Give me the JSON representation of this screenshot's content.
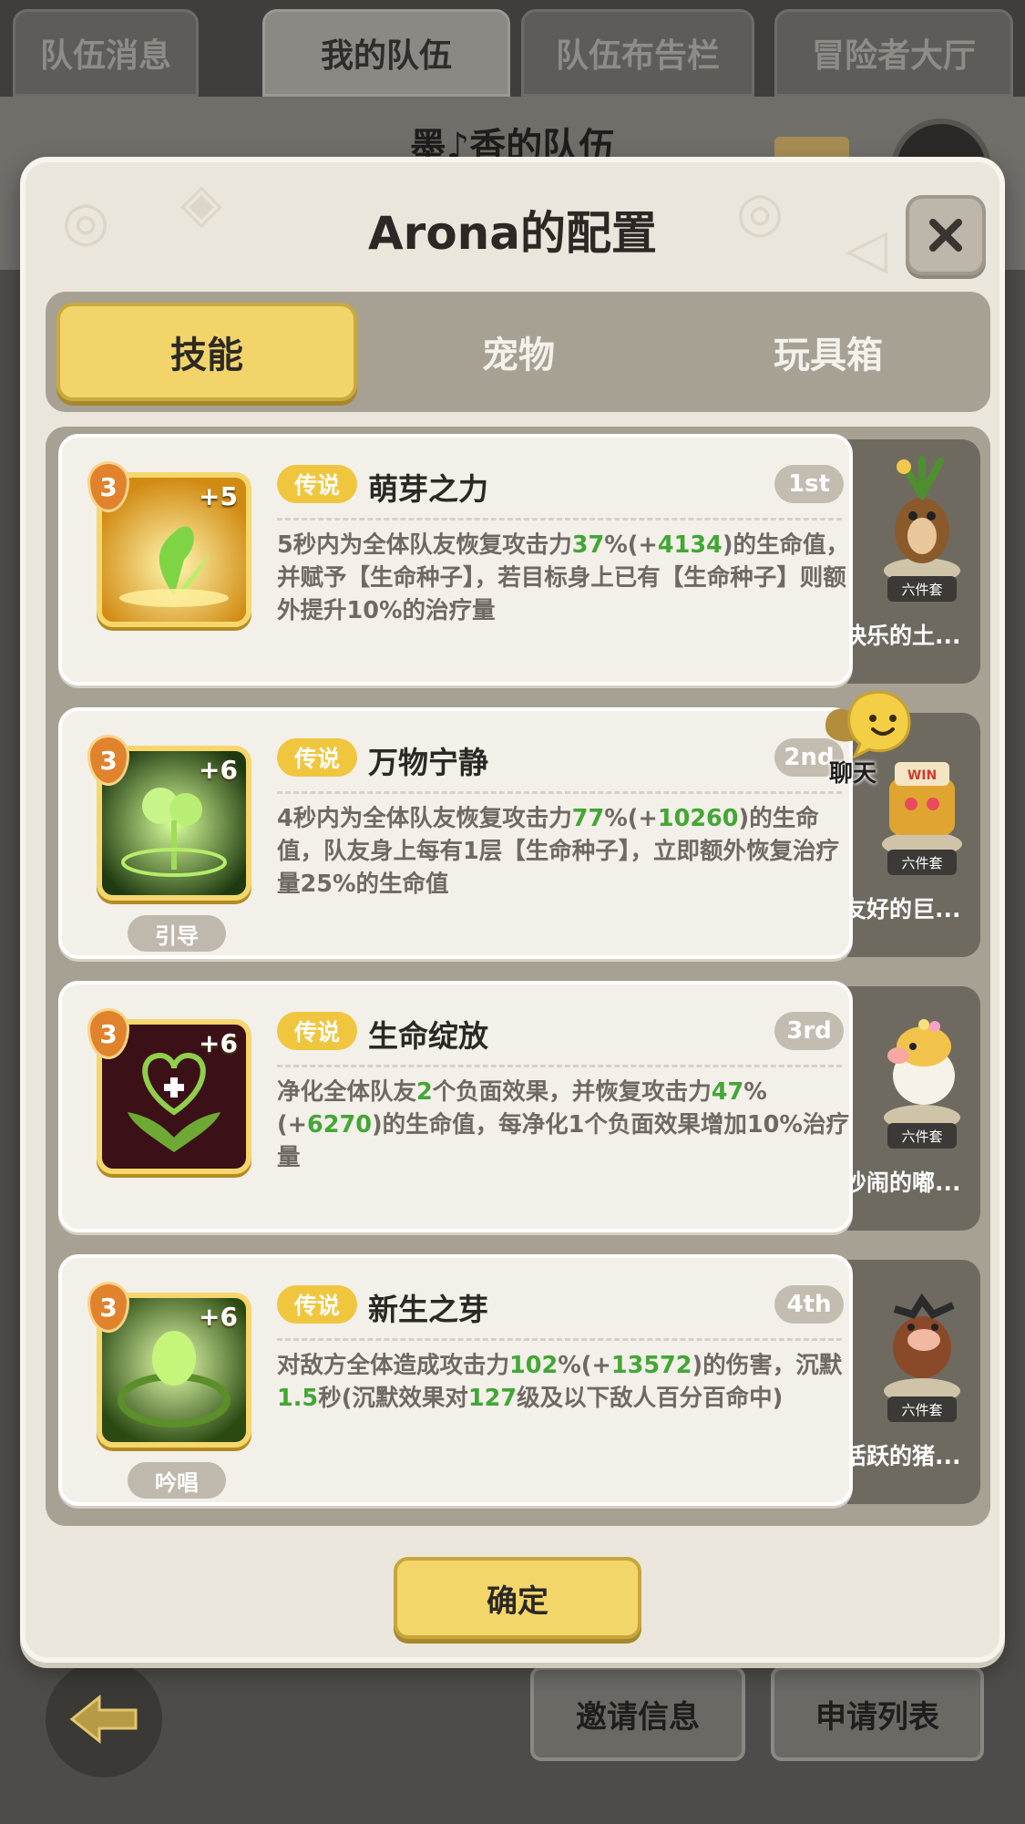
{
  "top_tabs": [
    "队伍消息",
    "我的队伍",
    "队伍布告栏",
    "冒险者大厅"
  ],
  "active_top_tab": 1,
  "background_title": "墨♪香的队伍",
  "modal": {
    "title": "Arona的配置",
    "tabs": [
      "技能",
      "宠物",
      "玩具箱"
    ],
    "active_tab": 0,
    "confirm_label": "确定"
  },
  "chat_label": "聊天",
  "bottom_buttons": [
    "邀请信息",
    "申请列表"
  ],
  "skills": [
    {
      "rarity": "传说",
      "name": "萌芽之力",
      "rank": "1st",
      "level": "3",
      "plus": "+5",
      "type_tag": "",
      "desc_parts": [
        {
          "t": "5秒内为全体队友恢复攻击力"
        },
        {
          "t": "37",
          "g": true
        },
        {
          "t": "%(+"
        },
        {
          "t": "4134",
          "g": true
        },
        {
          "t": ")的生命值，并赋予【生命种子】，若目标身上已有【生命种子】则额外提升10%的治疗量"
        }
      ],
      "pet_name": "快乐的土...",
      "pet_badge": "六件套"
    },
    {
      "rarity": "传说",
      "name": "万物宁静",
      "rank": "2nd",
      "level": "3",
      "plus": "+6",
      "type_tag": "引导",
      "desc_parts": [
        {
          "t": "4秒内为全体队友恢复攻击力"
        },
        {
          "t": "77",
          "g": true
        },
        {
          "t": "%(+"
        },
        {
          "t": "10260",
          "g": true
        },
        {
          "t": ")的生命值，队友身上每有1层【生命种子】，立即额外恢复治疗量25%的生命值"
        }
      ],
      "pet_name": "友好的巨...",
      "pet_badge": "六件套"
    },
    {
      "rarity": "传说",
      "name": "生命绽放",
      "rank": "3rd",
      "level": "3",
      "plus": "+6",
      "type_tag": "",
      "desc_parts": [
        {
          "t": "净化全体队友"
        },
        {
          "t": "2",
          "g": true
        },
        {
          "t": "个负面效果，并恢复攻击力"
        },
        {
          "t": "47",
          "g": true
        },
        {
          "t": "%(+"
        },
        {
          "t": "6270",
          "g": true
        },
        {
          "t": ")的生命值，每净化1个负面效果增加10%治疗量"
        }
      ],
      "pet_name": "吵闹的嘟...",
      "pet_badge": "六件套"
    },
    {
      "rarity": "传说",
      "name": "新生之芽",
      "rank": "4th",
      "level": "3",
      "plus": "+6",
      "type_tag": "吟唱",
      "desc_parts": [
        {
          "t": "对敌方全体造成攻击力"
        },
        {
          "t": "102",
          "g": true
        },
        {
          "t": "%(+"
        },
        {
          "t": "13572",
          "g": true
        },
        {
          "t": ")的伤害，沉默"
        },
        {
          "t": "1.5",
          "g": true
        },
        {
          "t": "秒(沉默效果对"
        },
        {
          "t": "127",
          "g": true
        },
        {
          "t": "级及以下敌人百分百命中)"
        }
      ],
      "pet_name": "活跃的猪...",
      "pet_badge": "六件套"
    }
  ]
}
